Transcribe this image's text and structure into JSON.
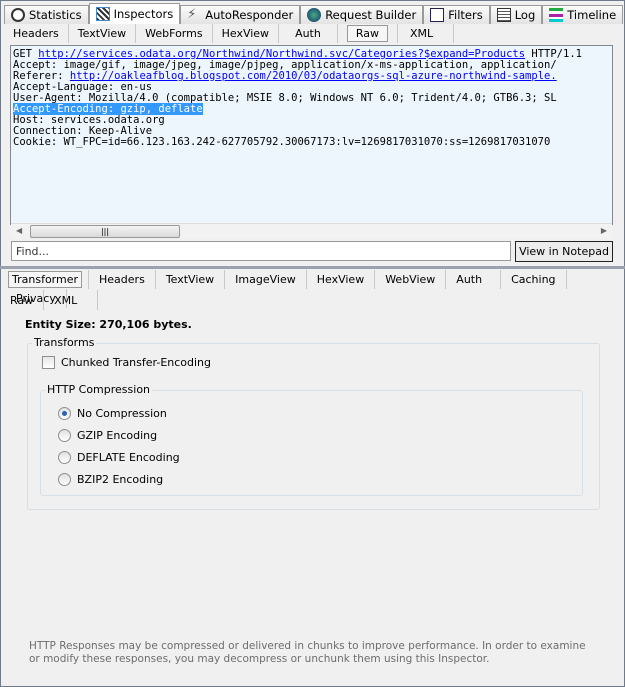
{
  "top_tabs": [
    {
      "label": "Statistics",
      "icon": "stopwatch-icon"
    },
    {
      "label": "Inspectors",
      "icon": "inspectors-icon"
    },
    {
      "label": "AutoResponder",
      "icon": "lightning-icon"
    },
    {
      "label": "Request Builder",
      "icon": "globe-tools-icon"
    },
    {
      "label": "Filters",
      "icon": "checkbox-icon"
    },
    {
      "label": "Log",
      "icon": "log-icon"
    },
    {
      "label": "Timeline",
      "icon": "timeline-icon"
    }
  ],
  "request_tabs": [
    "Headers",
    "TextView",
    "WebForms",
    "HexView",
    "Auth",
    "Raw",
    "XML"
  ],
  "request_raw": {
    "line1_prefix": "GET ",
    "line1_url": "http://services.odata.org/Northwind/Northwind.svc/Categories?$expand=Products",
    "line1_suffix": " HTTP/1.1",
    "line2": "Accept: image/gif, image/jpeg, image/pjpeg, application/x-ms-application, application/",
    "line3_prefix": "Referer: ",
    "line3_url": "http://oakleafblog.blogspot.com/2010/03/odataorgs-sql-azure-northwind-sample.",
    "line4": "Accept-Language: en-us",
    "line5": "User-Agent: Mozilla/4.0 (compatible; MSIE 8.0; Windows NT 6.0; Trident/4.0; GTB6.3; SL",
    "line6": "Accept-Encoding: gzip, deflate",
    "line7": "Host: services.odata.org",
    "line8": "Connection: Keep-Alive",
    "line9": "Cookie: WT_FPC=id=66.123.163.242-627705792.30067173:lv=1269817031070:ss=1269817031070"
  },
  "find_placeholder": "Find...",
  "view_in_notepad": "View in Notepad",
  "response_tabs": [
    "Transformer",
    "Headers",
    "TextView",
    "ImageView",
    "HexView",
    "WebView",
    "Auth",
    "Caching",
    "Privacy"
  ],
  "response_tabs_row2": [
    "Raw",
    "XML"
  ],
  "entity_size": "Entity Size: 270,106 bytes.",
  "transforms_label": "Transforms",
  "chunked_label": "Chunked Transfer-Encoding",
  "compression_label": "HTTP Compression",
  "compression_options": [
    "No Compression",
    "GZIP Encoding",
    "DEFLATE Encoding",
    "BZIP2 Encoding"
  ],
  "selected_compression": "No Compression",
  "footer": "HTTP Responses may be compressed or delivered in chunks to improve performance.  In order to examine or modify these responses, you may decompress or unchunk them using this Inspector."
}
